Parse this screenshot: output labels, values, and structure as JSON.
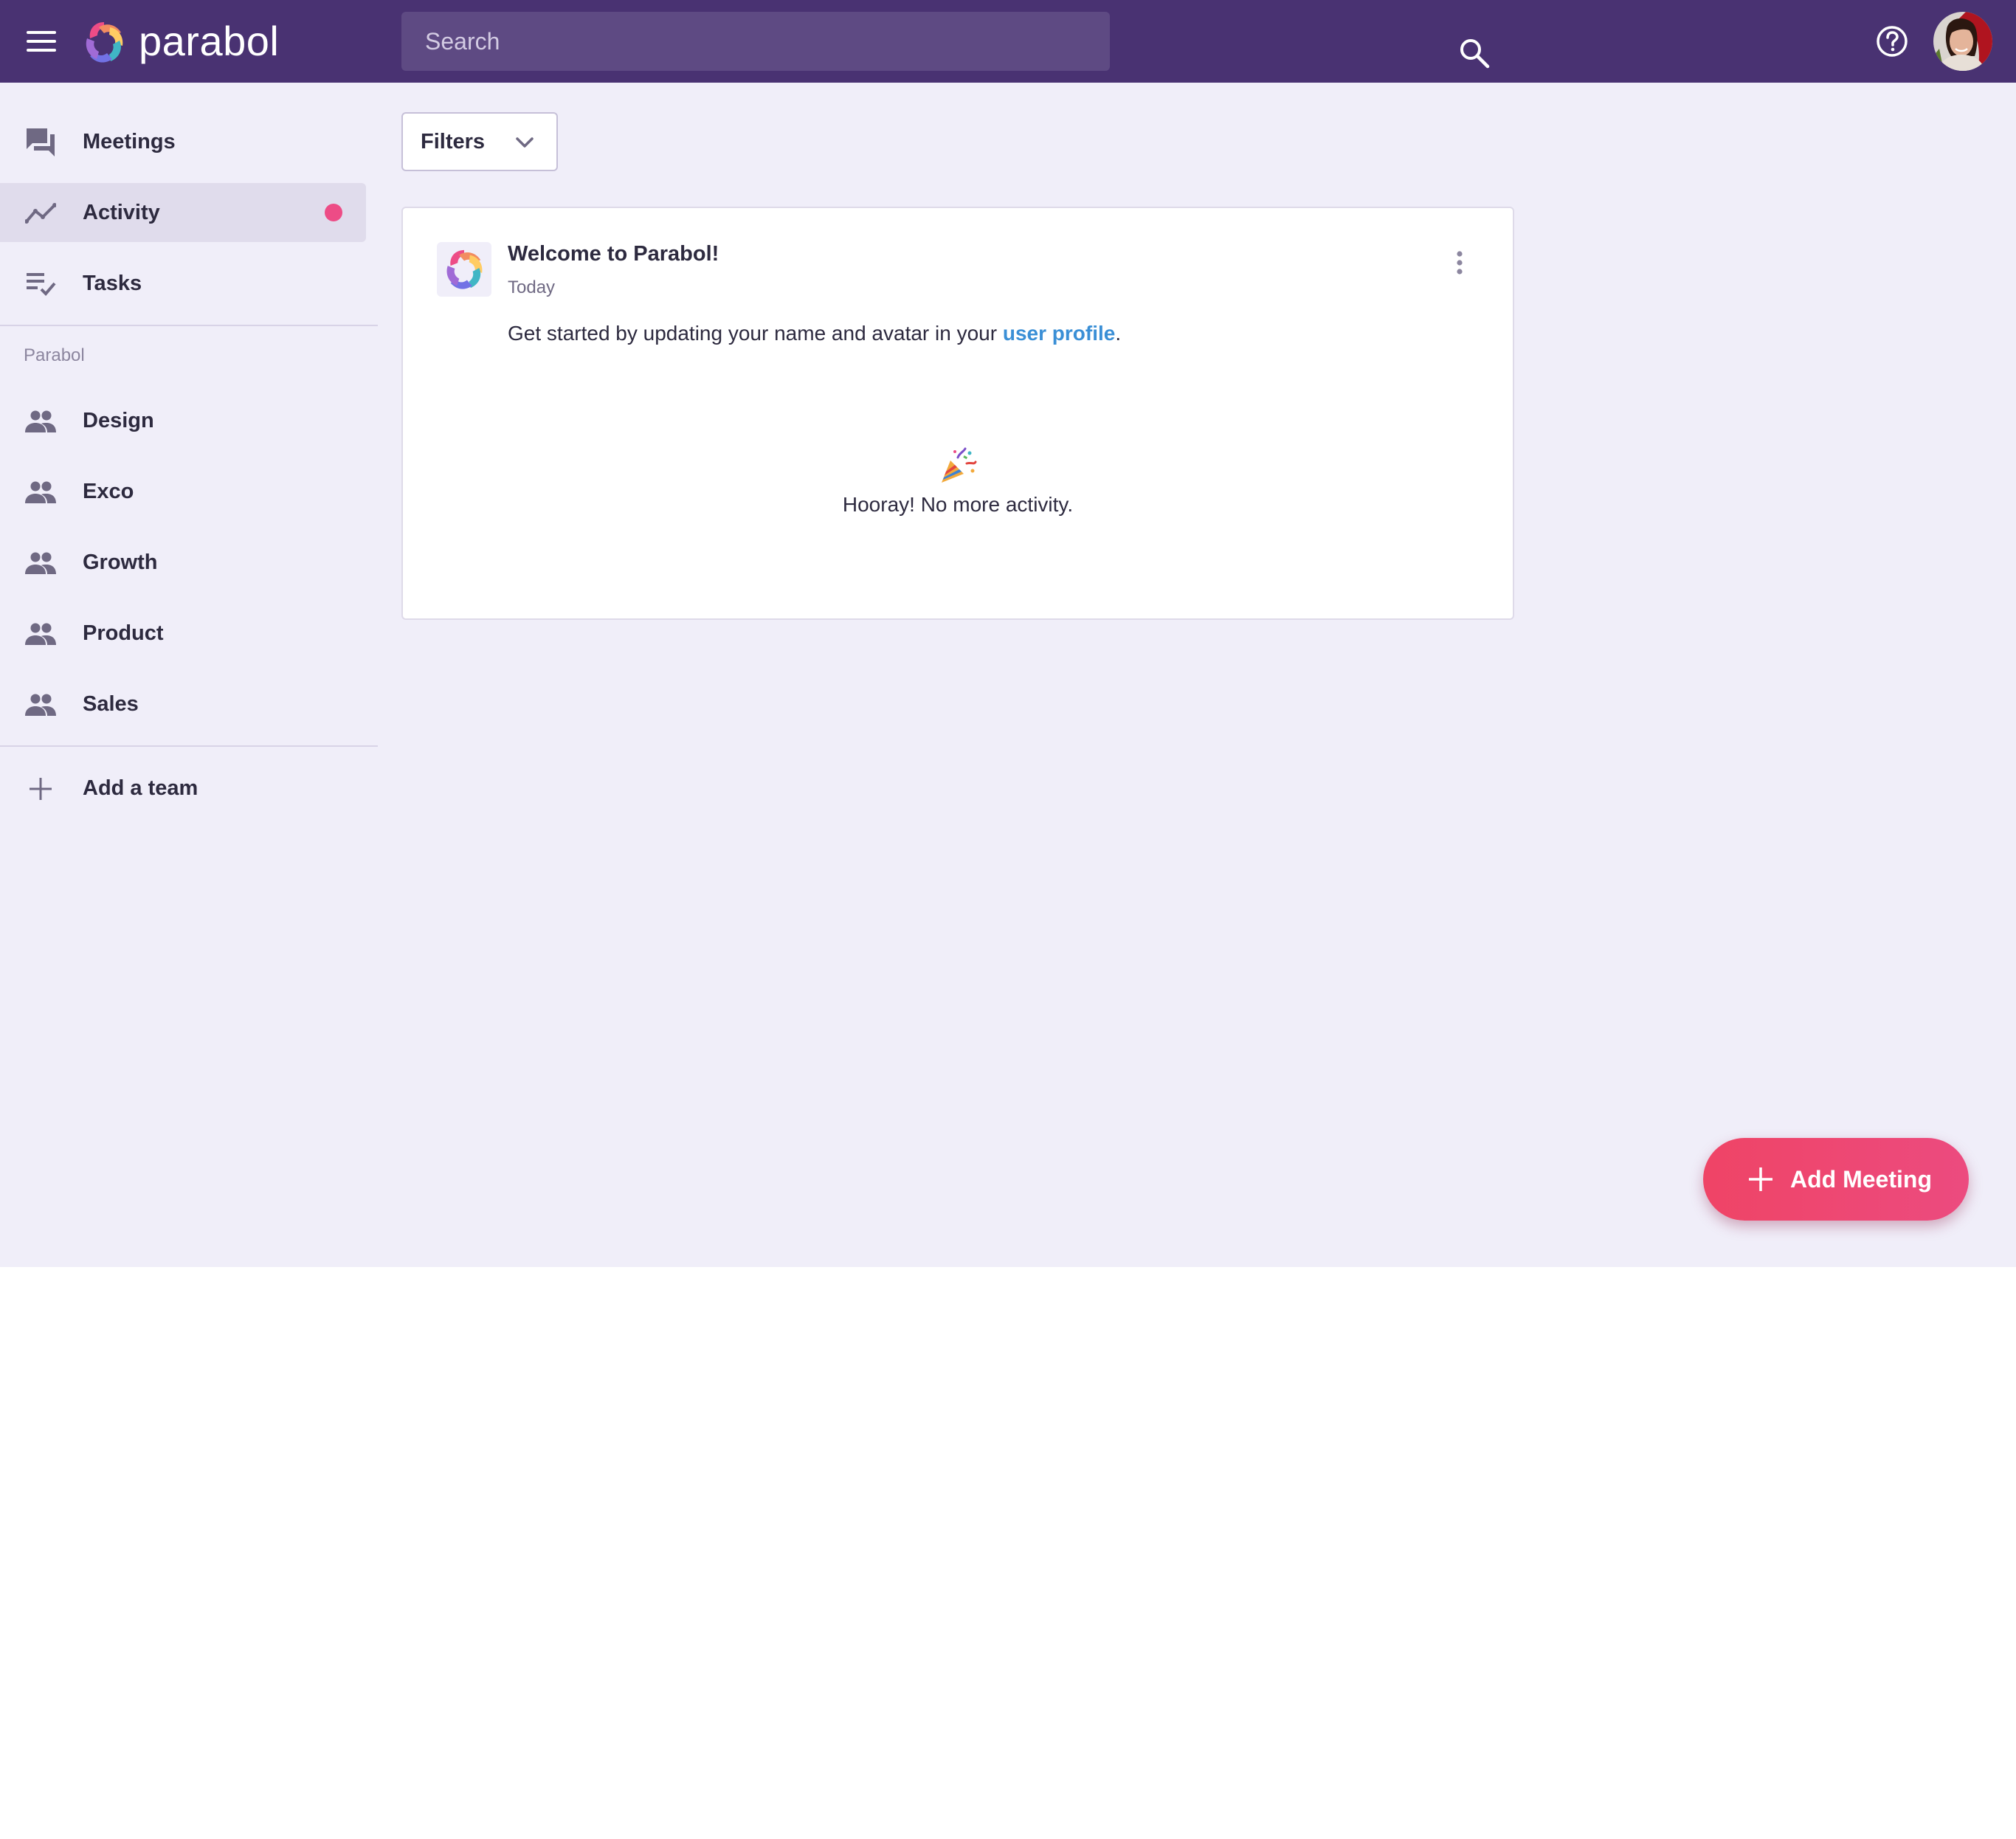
{
  "header": {
    "app_name": "parabol",
    "search_placeholder": "Search"
  },
  "sidebar": {
    "nav": [
      {
        "label": "Meetings",
        "icon": "forum-icon"
      },
      {
        "label": "Activity",
        "icon": "timeline-icon",
        "active": true,
        "has_notification": true
      },
      {
        "label": "Tasks",
        "icon": "playlist-check-icon"
      }
    ],
    "org_label": "Parabol",
    "teams": [
      {
        "label": "Design",
        "icon": "group-icon"
      },
      {
        "label": "Exco",
        "icon": "group-icon"
      },
      {
        "label": "Growth",
        "icon": "group-icon"
      },
      {
        "label": "Product",
        "icon": "group-icon"
      },
      {
        "label": "Sales",
        "icon": "group-icon"
      }
    ],
    "add_team_label": "Add a team"
  },
  "filters": {
    "label": "Filters"
  },
  "card": {
    "title": "Welcome to Parabol!",
    "date": "Today",
    "body_prefix": "Get started by updating your name and avatar in your ",
    "body_link": "user profile",
    "body_suffix": "."
  },
  "empty_state": {
    "text": "Hooray! No more activity."
  },
  "fab": {
    "label": "Add Meeting"
  },
  "colors": {
    "header_bg": "#493272",
    "page_bg": "#f0eef9",
    "accent_pink": "#ed4c86",
    "link_blue": "#3a8fd6"
  }
}
